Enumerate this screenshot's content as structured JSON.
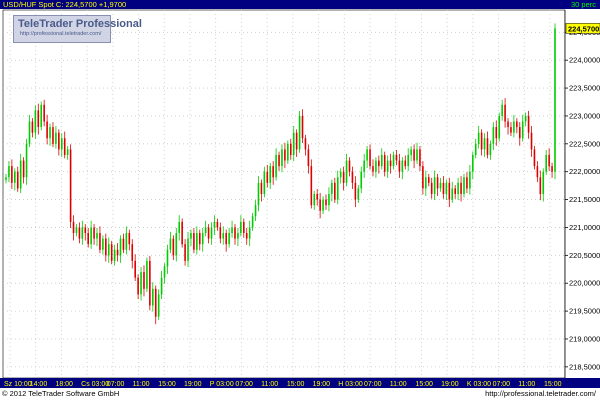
{
  "header": {
    "title": "USD/HUF Spot  C: 224,5700  +1,9700",
    "period": "30 perc"
  },
  "logo": {
    "brand": "TeleTrader Professional",
    "url": "http://professional.teletrader.com/"
  },
  "footer": {
    "copyright": "© 2012 TeleTrader Software GmbH",
    "url": "http://professional.teletrader.com/"
  },
  "colors": {
    "up": "#00cc00",
    "down": "#dd0000",
    "axis_bg": "#000080",
    "axis_text": "#ffff00",
    "last_price_bg": "#ffff00",
    "grid": "#c8c8c8"
  },
  "chart_data": {
    "type": "candlestick",
    "instrument": "USD/HUF Spot",
    "last_price_label": "224,5700",
    "ylim": [
      218.3,
      224.9
    ],
    "y_ticks": [
      "218,5000",
      "219,0000",
      "219,5000",
      "220,0000",
      "220,5000",
      "221,0000",
      "221,5000",
      "222,0000",
      "222,5000",
      "223,0000",
      "223,5000",
      "224,0000",
      "224,5000"
    ],
    "y_tick_values": [
      218.5,
      219.0,
      219.5,
      220.0,
      220.5,
      221.0,
      221.5,
      222.0,
      222.5,
      223.0,
      223.5,
      224.0,
      224.5
    ],
    "x_tick_labels": [
      "Sz 10:00",
      "14:00",
      "18:00",
      "Cs 03:00",
      "07:00",
      "11:00",
      "15:00",
      "19:00",
      "P 03:00",
      "07:00",
      "11:00",
      "15:00",
      "19:00",
      "H 03:00",
      "07:00",
      "11:00",
      "15:00",
      "19:00",
      "K 03:00",
      "07:00",
      "11:00",
      "15:00"
    ],
    "closes": [
      221.9,
      222.1,
      221.8,
      222.0,
      221.7,
      222.2,
      221.9,
      222.5,
      222.9,
      222.7,
      223.1,
      222.8,
      223.2,
      222.9,
      222.6,
      222.8,
      222.5,
      222.7,
      222.4,
      222.6,
      222.3,
      222.4,
      221.1,
      220.9,
      221.0,
      220.8,
      221.0,
      220.9,
      220.7,
      221.0,
      220.8,
      220.9,
      220.6,
      220.8,
      220.5,
      220.7,
      220.4,
      220.6,
      220.5,
      220.8,
      220.6,
      220.9,
      220.7,
      220.4,
      220.1,
      219.8,
      220.2,
      219.9,
      220.4,
      219.6,
      219.9,
      219.4,
      219.8,
      220.1,
      220.3,
      220.6,
      220.8,
      220.5,
      220.9,
      221.1,
      220.7,
      220.4,
      220.8,
      220.9,
      220.6,
      220.9,
      220.7,
      220.9,
      221.0,
      220.8,
      221.0,
      221.1,
      221.0,
      220.8,
      220.9,
      220.7,
      220.9,
      221.0,
      220.8,
      220.9,
      221.1,
      220.9,
      220.8,
      221.0,
      221.2,
      221.4,
      221.8,
      221.6,
      222.0,
      221.8,
      222.1,
      221.9,
      222.3,
      222.1,
      222.4,
      222.2,
      222.5,
      222.3,
      222.7,
      222.4,
      223.0,
      222.6,
      222.4,
      222.1,
      221.4,
      221.6,
      221.5,
      221.3,
      221.5,
      221.4,
      221.6,
      221.8,
      221.5,
      221.9,
      222.0,
      221.8,
      222.2,
      222.0,
      221.8,
      221.5,
      221.7,
      222.0,
      222.2,
      222.4,
      222.1,
      222.0,
      222.2,
      222.1,
      222.3,
      222.0,
      222.2,
      222.1,
      222.3,
      222.2,
      222.0,
      222.2,
      222.1,
      222.3,
      222.4,
      222.2,
      222.4,
      222.1,
      221.7,
      221.9,
      221.8,
      221.6,
      221.9,
      221.7,
      221.8,
      221.6,
      221.8,
      221.5,
      221.7,
      221.6,
      221.8,
      221.6,
      221.9,
      221.7,
      222.0,
      222.3,
      222.5,
      222.7,
      222.4,
      222.6,
      222.3,
      222.5,
      222.8,
      222.6,
      223.0,
      223.2,
      222.9,
      222.8,
      222.7,
      222.9,
      222.8,
      222.6,
      222.9,
      223.0,
      222.7,
      222.4,
      222.1,
      221.9,
      221.6,
      222.0,
      222.3,
      222.1,
      222.0,
      224.57
    ]
  }
}
